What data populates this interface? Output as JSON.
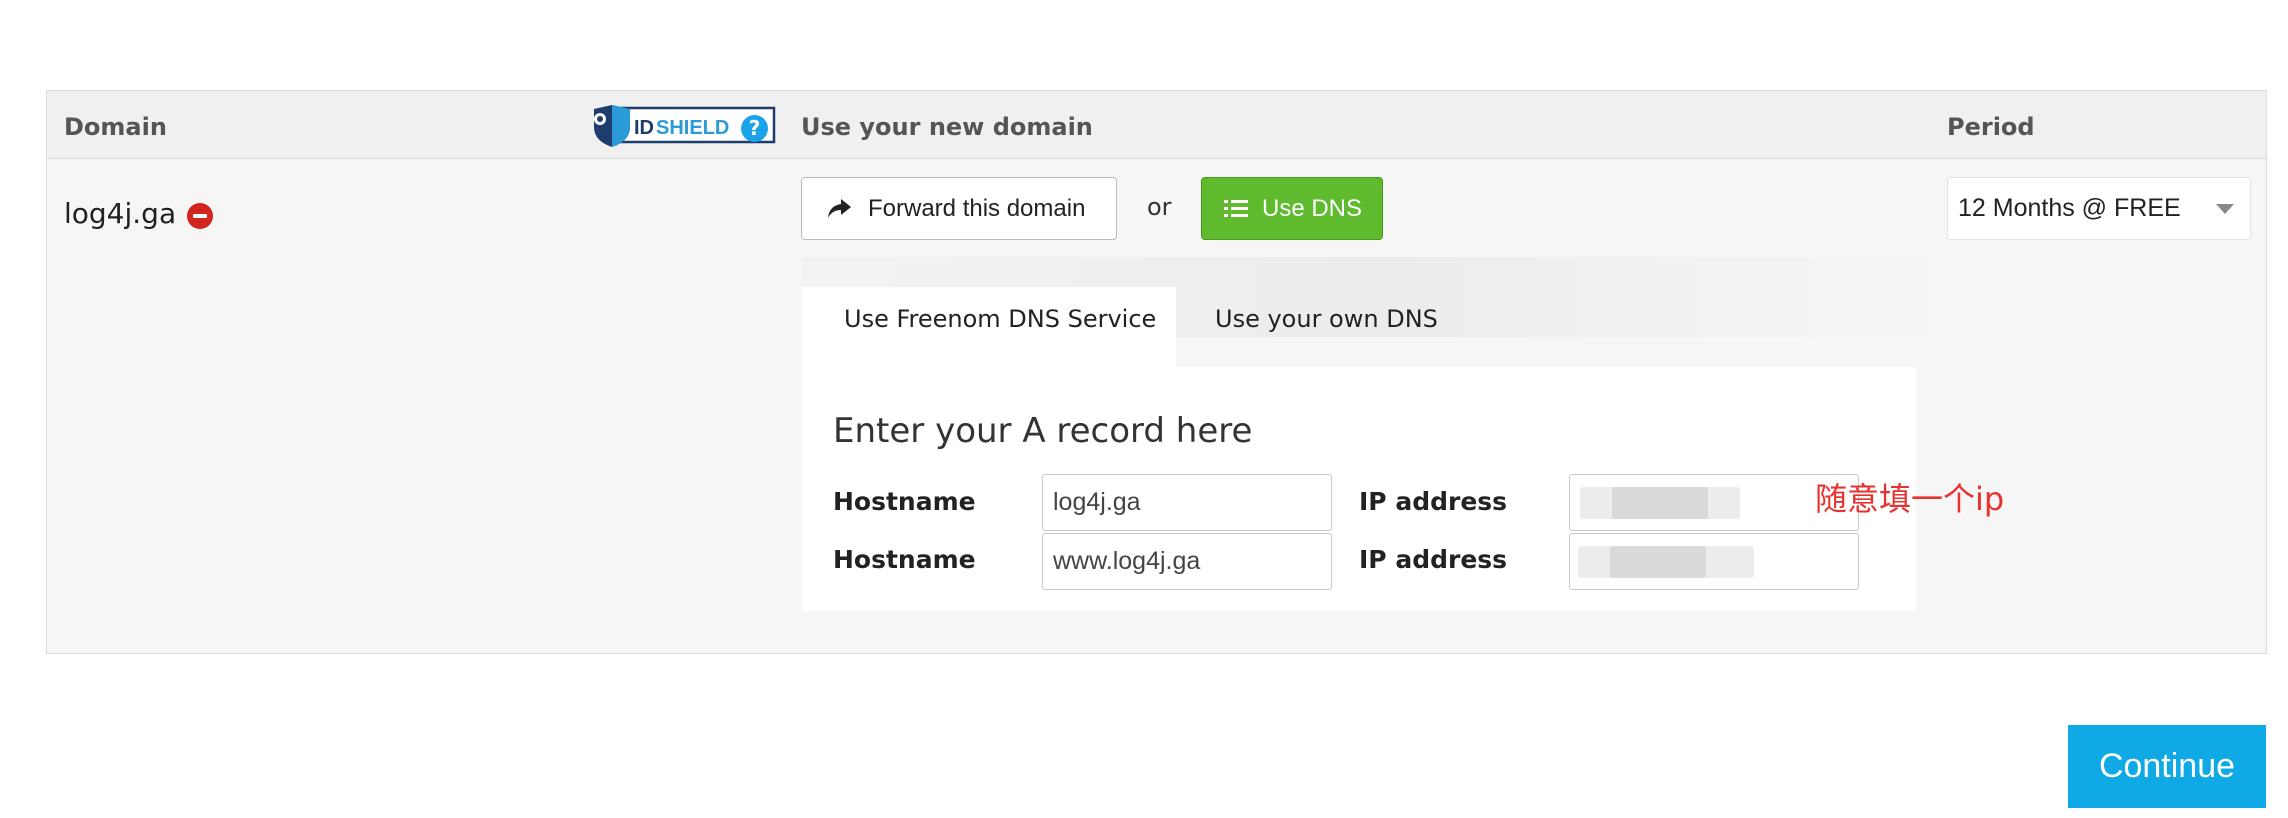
{
  "table": {
    "headers": {
      "domain": "Domain",
      "use_domain": "Use your new domain",
      "period": "Period"
    },
    "idshield_logo_text": "IDSHIELD",
    "help_icon": "?"
  },
  "domain_row": {
    "name": "log4j.ga",
    "remove_icon": "minus-circle-icon"
  },
  "actions": {
    "forward_label": "Forward this domain",
    "forward_icon": "share-arrow-icon",
    "or_text": "or",
    "dns_label": "Use DNS",
    "dns_icon": "list-icon"
  },
  "period": {
    "selected": "12 Months @ FREE"
  },
  "dns_tabs": [
    {
      "label": "Use Freenom DNS Service",
      "active": true
    },
    {
      "label": "Use your own DNS",
      "active": false
    }
  ],
  "dns_form": {
    "title": "Enter your A record here",
    "rows": [
      {
        "hostname_label": "Hostname",
        "hostname_value": "log4j.ga",
        "ip_label": "IP address",
        "ip_value": ""
      },
      {
        "hostname_label": "Hostname",
        "hostname_value": "www.log4j.ga",
        "ip_label": "IP address",
        "ip_value": ""
      }
    ]
  },
  "annotation": "随意填一个ip",
  "continue_label": "Continue",
  "colors": {
    "green_button": "#5fba2e",
    "blue_button": "#0fa9e6",
    "remove_red": "#d0261f",
    "annotation_red": "#e8322f",
    "help_blue": "#1aa3e8"
  }
}
